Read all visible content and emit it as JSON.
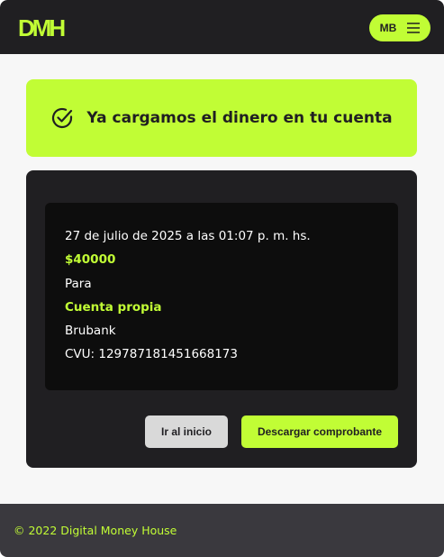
{
  "header": {
    "logo": "DMH",
    "user_initials": "MB",
    "accent": "#c1fd35"
  },
  "banner": {
    "message": "Ya cargamos el dinero en tu cuenta",
    "icon": "check-circle-icon"
  },
  "details": {
    "date": "27 de julio de 2025 a las 01:07 p. m. hs.",
    "amount": "$40000",
    "to_label": "Para",
    "account": "Cuenta propia",
    "bank": "Brubank",
    "cvu": "CVU: 129787181451668173"
  },
  "actions": {
    "home": "Ir al inicio",
    "download": "Descargar comprobante"
  },
  "footer": {
    "text": "© 2022 Digital Money House"
  }
}
